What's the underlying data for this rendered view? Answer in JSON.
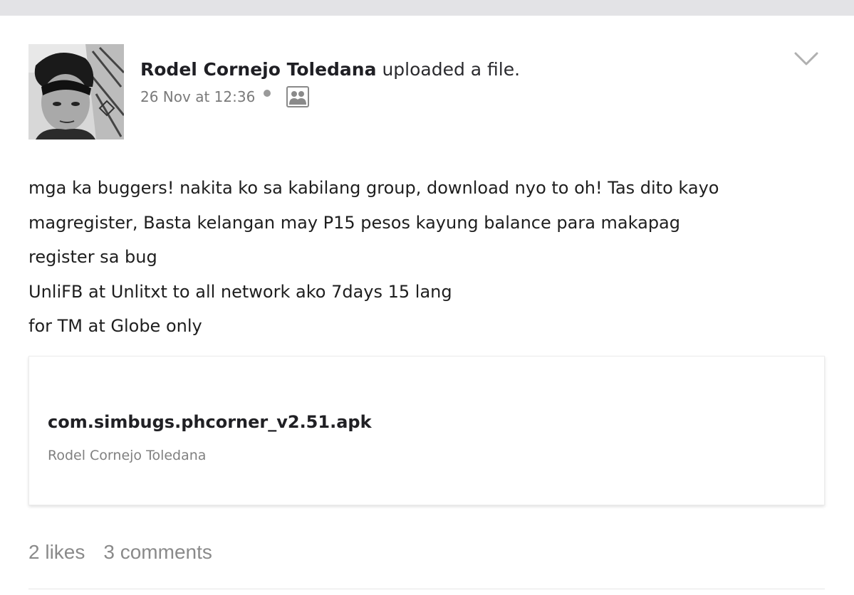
{
  "post": {
    "author": "Rodel Cornejo Toledana",
    "action": "uploaded a file.",
    "timestamp": "26 Nov at 12:36",
    "privacy_icon": "friends-icon",
    "menu_icon": "chevron-down-icon",
    "body_lines": [
      "mga ka buggers! nakita ko sa kabilang group, download nyo to oh! Tas dito kayo",
      "magregister, Basta kelangan may P15 pesos kayung balance para makapag",
      "register sa bug",
      "UnliFB at Unlitxt to all network ako 7days 15 lang",
      "for TM at Globe only"
    ],
    "attachment": {
      "file_name": "com.simbugs.phcorner_v2.51.apk",
      "owner": "Rodel Cornejo Toledana"
    },
    "stats": {
      "likes": "2 likes",
      "comments": "3 comments"
    }
  },
  "colors": {
    "top_strip": "#e3e3e6",
    "text": "#1c1c1c",
    "muted": "#8a8a8a"
  }
}
